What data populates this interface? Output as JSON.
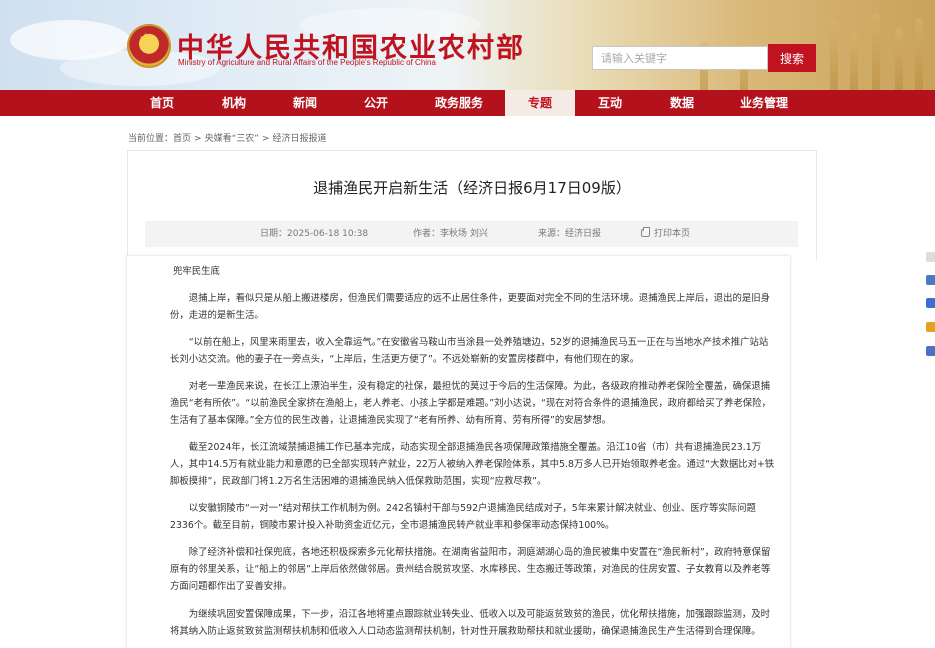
{
  "header": {
    "site_title": "中华人民共和国农业农村部",
    "site_subtitle": "Ministry of Agriculture and Rural Affairs of the People's Republic of China",
    "search_placeholder": "请输入关键字",
    "search_button": "搜索"
  },
  "nav": {
    "items": [
      {
        "label": "首页"
      },
      {
        "label": "机构"
      },
      {
        "label": "新闻"
      },
      {
        "label": "公开"
      },
      {
        "label": "政务服务"
      },
      {
        "label": "专题"
      },
      {
        "label": "互动"
      },
      {
        "label": "数据"
      },
      {
        "label": "业务管理"
      }
    ],
    "active": "专题"
  },
  "breadcrumb": {
    "prefix": "当前位置：",
    "items": [
      "首页",
      "央媒看“三农”",
      "经济日报报道"
    ],
    "sep": ">"
  },
  "article": {
    "title": "退捕渔民开启新生活（经济日报6月17日09版）",
    "date_label": "日期：",
    "date": "2025-06-18 10:38",
    "author_label": "作者：",
    "author": "李秋场 刘兴",
    "source_label": "来源：",
    "source": "经济日报",
    "print_label": "打印本页",
    "paragraphs": [
      "兜牢民生底",
      "退捕上岸，看似只是从船上搬进楼房，但渔民们需要适应的远不止居住条件，更要面对完全不同的生活环境。退捕渔民上岸后，退出的是旧身份，走进的是新生活。",
      "“以前在船上，风里来雨里去，收入全靠运气。”在安徽省马鞍山市当涂县一处养殖塘边，52岁的退捕渔民马五一正在与当地水产技术推广站站长刘小达交流。他的妻子在一旁点头，“上岸后，生活更方便了”。不远处崭新的安置房楼群中，有他们现在的家。",
      "对老一辈渔民来说，在长江上漂泊半生，没有稳定的社保，最担忧的莫过于今后的生活保障。为此，各级政府推动养老保险全覆盖，确保退捕渔民“老有所依”。“以前渔民全家挤在渔船上，老人养老、小孩上学都是难题。”刘小达说，“现在对符合条件的退捕渔民，政府都给买了养老保险，生活有了基本保障。”全方位的民生改善，让退捕渔民实现了“老有所养、幼有所育、劳有所得”的安居梦想。",
      "截至2024年，长江流域禁捕退捕工作已基本完成，动态实现全部退捕渔民各项保障政策措施全覆盖。沿江10省（市）共有退捕渔民23.1万人，其中14.5万有就业能力和意愿的已全部实现转产就业，22万人被纳入养老保险体系，其中5.8万多人已开始领取养老金。通过“大数据比对+铁脚板摸排”，民政部门将1.2万名生活困难的退捕渔民纳入低保救助范围，实现“应救尽救”。",
      "以安徽铜陵市“一对一”结对帮扶工作机制为例。242名镇村干部与592户退捕渔民结成对子，5年来累计解决就业、创业、医疗等实际问题2336个。截至目前，铜陵市累计投入补助资金近亿元，全市退捕渔民转产就业率和参保率动态保持100%。",
      "除了经济补偿和社保兜底，各地还积极探索多元化帮扶措施。在湖南省益阳市，洞庭湖湖心岛的渔民被集中安置在“渔民新村”，政府特意保留原有的邻里关系，让“船上的邻居”上岸后依然做邻居。贵州结合脱贫攻坚、水库移民、生态搬迁等政策，对渔民的住房安置、子女教育以及养老等方面问题都作出了妥善安排。",
      "为继续巩固安置保障成果，下一步，沿江各地将重点跟踪就业转失业、低收入以及可能返贫致贫的渔民，优化帮扶措施，加强跟踪监测，及时将其纳入防止返贫致贫监测帮扶机制和低收入人口动态监测帮扶机制，针对性开展救助帮扶和就业援助，确保退捕渔民生产生活得到合理保障。"
    ]
  },
  "side_icons": [
    "side-icon-1",
    "side-icon-2",
    "side-icon-3",
    "side-icon-4",
    "side-icon-5"
  ],
  "colors": {
    "brand_red": "#c1121f",
    "nav_red": "#b3121c",
    "active_tab_bg": "#f4ece4"
  }
}
